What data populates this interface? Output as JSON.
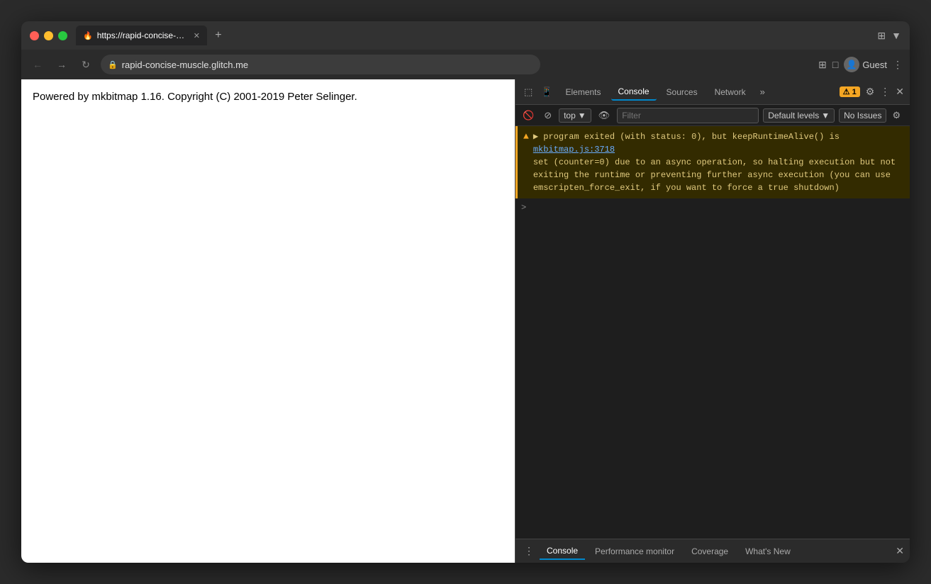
{
  "browser": {
    "traffic_lights": [
      "red",
      "yellow",
      "green"
    ],
    "tab": {
      "favicon": "🔥",
      "title": "https://rapid-concise-muscle.g…",
      "close": "✕"
    },
    "new_tab": "+",
    "title_bar_icons": [
      "⊞",
      "▼"
    ],
    "nav": {
      "back": "←",
      "forward": "→",
      "refresh": "↻"
    },
    "url": {
      "lock": "🔒",
      "text": "rapid-concise-muscle.glitch.me"
    },
    "address_right_icons": [
      "⊞",
      "□"
    ],
    "user": {
      "label": "Guest"
    },
    "more": "⋮"
  },
  "webpage": {
    "content": "Powered by mkbitmap 1.16. Copyright (C) 2001-2019 Peter Selinger."
  },
  "devtools": {
    "tabs": [
      "Elements",
      "Console",
      "Sources",
      "Network"
    ],
    "active_tab": "Console",
    "more_tabs": "»",
    "warning_badge": "⚠ 1",
    "settings_icon": "⚙",
    "more_icon": "⋮",
    "close_icon": "✕",
    "toolbar": {
      "inspect_icon": "⬚",
      "device_icon": "□",
      "context": "top",
      "context_arrow": "▼",
      "eye_icon": "👁",
      "filter_placeholder": "Filter",
      "levels": "Default levels",
      "levels_arrow": "▼",
      "no_issues": "No Issues",
      "settings_gear": "⚙"
    },
    "console_output": {
      "warning": {
        "icon": "▲",
        "text_line1": "▶ program exited (with status: 0), but keepRuntimeAlive() is",
        "link_text": "mkbitmap.js:3718",
        "text_line2": "set (counter=0) due to an async operation, so halting execution but not",
        "text_line3": "exiting the runtime or preventing further async execution (you can use",
        "text_line4": "emscripten_force_exit, if you want to force a true shutdown)"
      },
      "prompt": ">"
    },
    "bottom_bar": {
      "menu_icon": "⋮",
      "tabs": [
        "Console",
        "Performance monitor",
        "Coverage",
        "What's New"
      ],
      "active_tab": "Console",
      "close": "✕"
    }
  }
}
